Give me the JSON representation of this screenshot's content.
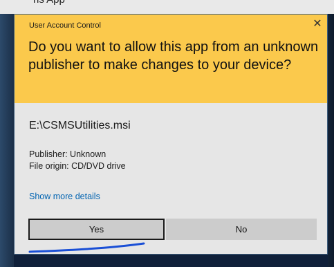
{
  "background": {
    "partial_top_text": "ns App"
  },
  "dialog": {
    "title": "User Account Control",
    "close_glyph": "✕",
    "question": "Do you want to allow this app from an unknown publisher to make changes to your device?",
    "file_name": "E:\\CSMSUtilities.msi",
    "publisher_line": "Publisher: Unknown",
    "origin_line": "File origin: CD/DVD drive",
    "details_link": "Show more details",
    "yes_label": "Yes",
    "no_label": "No"
  },
  "colors": {
    "header_bg": "#fbc94c",
    "body_bg": "#e6e6e6",
    "link": "#0063b1",
    "button_bg": "#cccccc",
    "annotation_stroke": "#1a4fd6"
  },
  "icons": {
    "close": "close-icon"
  }
}
